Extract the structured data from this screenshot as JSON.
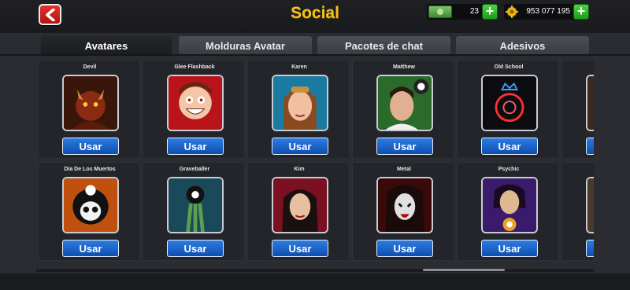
{
  "header": {
    "title": "Social",
    "cash_value": "23",
    "coin_value": "953 077 195"
  },
  "tabs": [
    {
      "label": "Avatares"
    },
    {
      "label": "Molduras Avatar"
    },
    {
      "label": "Pacotes de chat"
    },
    {
      "label": "Adesivos"
    }
  ],
  "avatars": [
    {
      "name": "Devil",
      "button": "Usar"
    },
    {
      "name": "Glee Flashback",
      "button": "Usar"
    },
    {
      "name": "Karen",
      "button": "Usar"
    },
    {
      "name": "Matthew",
      "button": "Usar"
    },
    {
      "name": "Old School",
      "button": "Usar"
    },
    {
      "name": "Dia De Los Muertos",
      "button": "Usar"
    },
    {
      "name": "Graveballer",
      "button": "Usar"
    },
    {
      "name": "Kim",
      "button": "Usar"
    },
    {
      "name": "Metal",
      "button": "Usar"
    },
    {
      "name": "Psychic",
      "button": "Usar"
    }
  ],
  "colors": {
    "accent_title": "#f7c31c",
    "button_blue": "#1a62c8",
    "back_red": "#c8201a",
    "plus_green": "#2bb625"
  }
}
